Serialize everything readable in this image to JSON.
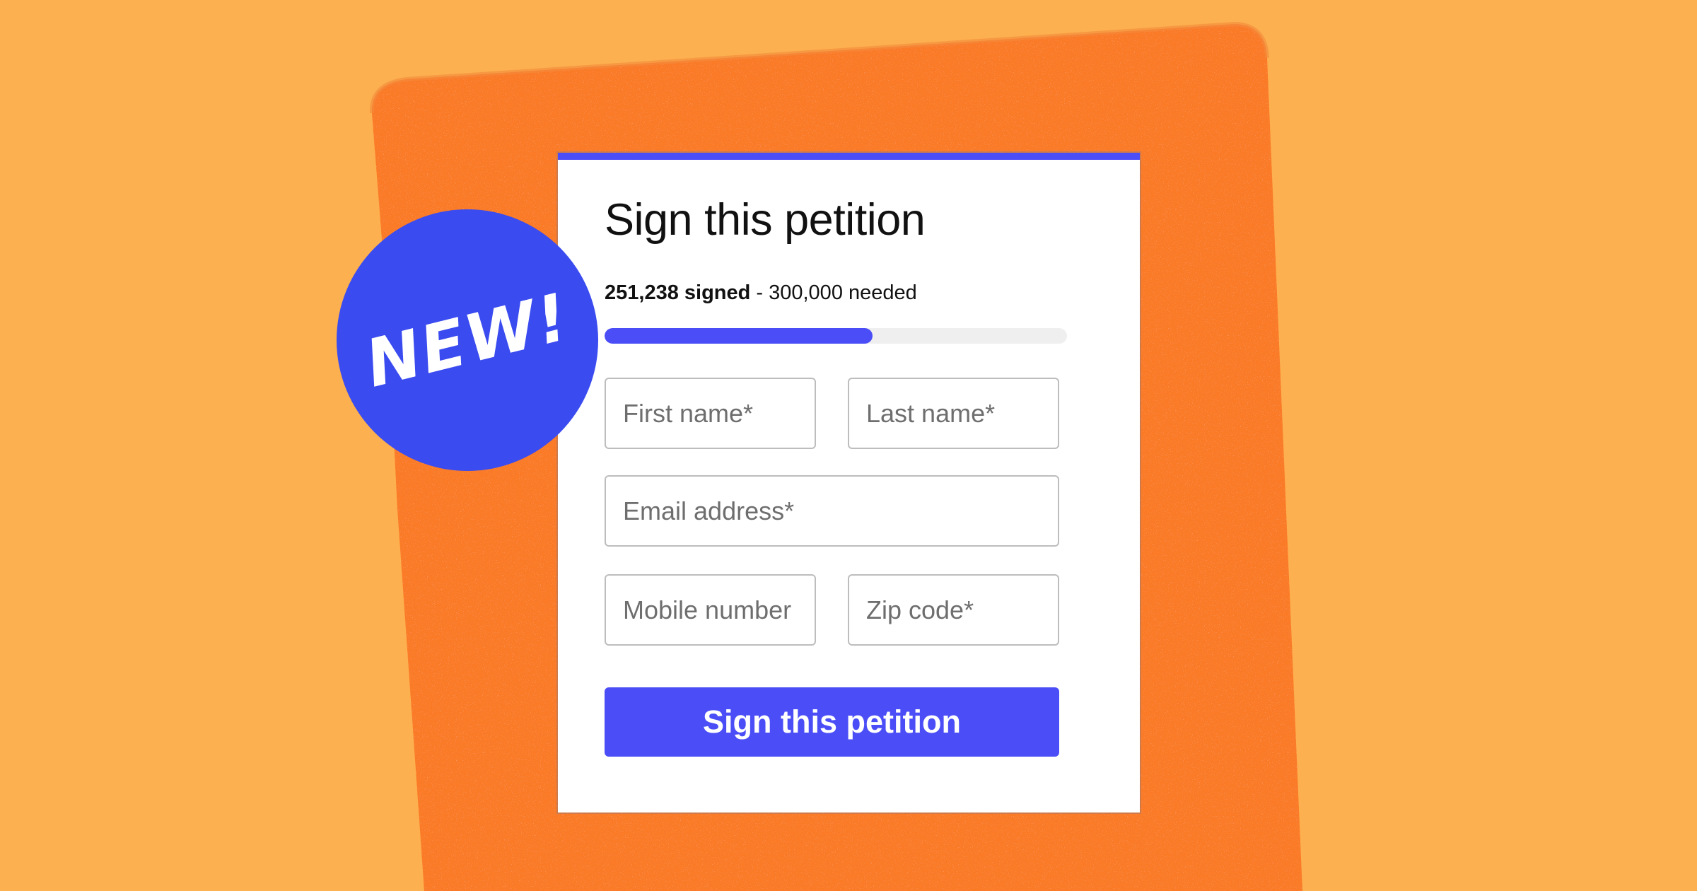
{
  "colors": {
    "background": "#FDB04F",
    "paper": "#FA7A25",
    "accent": "#4B4EF7",
    "badge": "#3A4BF0"
  },
  "badge": {
    "label": "NEW!"
  },
  "form": {
    "title": "Sign this petition",
    "signed_text": "251,238 signed",
    "needed_text": " - 300,000 needed",
    "signed_count": 251238,
    "goal_count": 300000,
    "progress_percent": 58,
    "fields": {
      "first_name": "First name*",
      "last_name": "Last name*",
      "email": "Email address*",
      "mobile": "Mobile number",
      "zip": "Zip code*"
    },
    "submit_label": "Sign this petition"
  }
}
